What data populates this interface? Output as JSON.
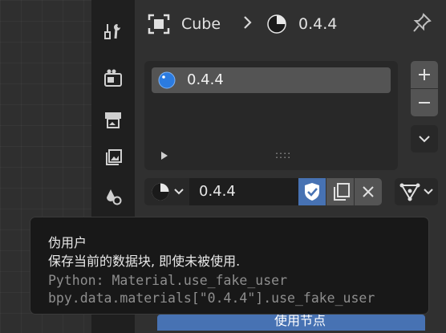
{
  "header": {
    "object_name": "Cube",
    "material_name": "0.4.4",
    "separator": "›"
  },
  "material_slots": {
    "items": [
      {
        "label": "0.4.4"
      }
    ],
    "add_icon": "plus-icon",
    "remove_icon": "minus-icon",
    "specials_icon": "chevron-down-icon",
    "expand_icon": "triangle-right-icon",
    "resize_handle": "::::"
  },
  "material_selector": {
    "name_value": "0.4.4",
    "fake_user_active": true
  },
  "tooltip": {
    "title": "伪用户",
    "description": "保存当前的数据块, 即使未被使用.",
    "python_line1": "Python: Material.use_fake_user",
    "python_line2": "bpy.data.materials[\"0.4.4\"].use_fake_user"
  },
  "bottom_button": {
    "label": "使用节点"
  },
  "colors": {
    "accent": "#4772b3",
    "panel_bg": "#303030",
    "tabbar_bg": "#1f1f1f",
    "tooltip_bg": "#181818"
  }
}
